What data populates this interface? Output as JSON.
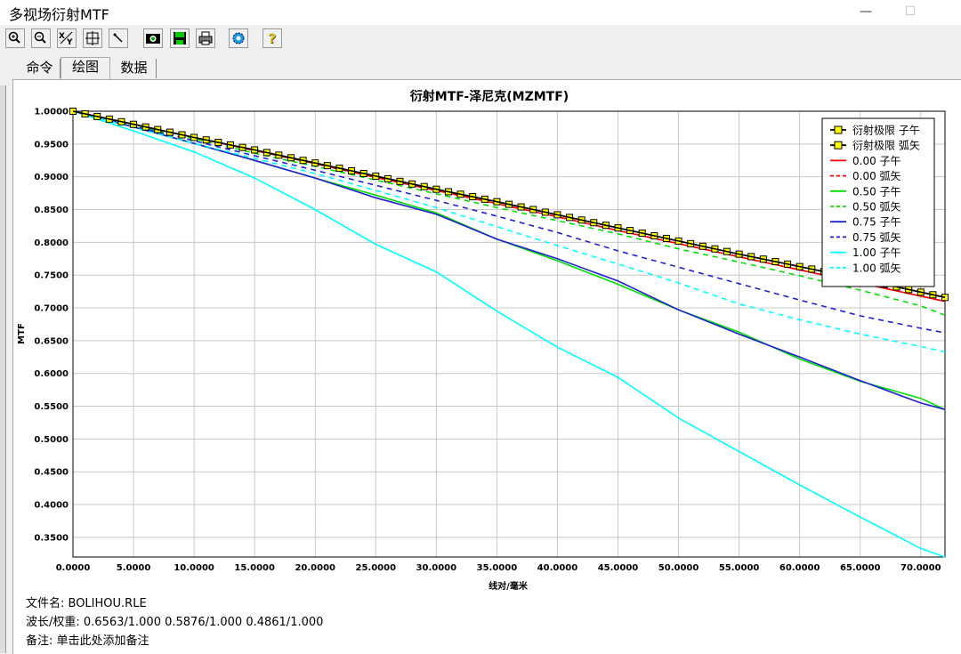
{
  "window": {
    "title": "多视场衍射MTF",
    "minimize": "—",
    "maximize": "☐"
  },
  "toolbar": {
    "icons": [
      "zoom-in-icon",
      "zoom-out-icon",
      "xy-icon",
      "fit-icon",
      "pen-icon",
      "camera-icon",
      "save-icon",
      "print-icon",
      "settings-icon",
      "help-icon"
    ]
  },
  "tabs": [
    {
      "label": "命令"
    },
    {
      "label": "绘图"
    },
    {
      "label": "数据"
    }
  ],
  "info": {
    "filename": "文件名:  BOLIHOU.RLE",
    "wavelengths": "波长/权重:  0.6563/1.000  0.5876/1.000  0.4861/1.000",
    "note": "备注:  单击此处添加备注"
  },
  "chart_data": {
    "type": "line",
    "title": "衍射MTF-泽尼克(MZMTF)",
    "xlabel": "线对/毫米",
    "ylabel": "MTF",
    "xlim": [
      0,
      72
    ],
    "ylim": [
      0.32,
      1.0
    ],
    "xticks": [
      "0.0000",
      "5.0000",
      "10.0000",
      "15.0000",
      "20.0000",
      "25.0000",
      "30.0000",
      "35.0000",
      "40.0000",
      "45.0000",
      "50.0000",
      "55.0000",
      "60.0000",
      "65.0000",
      "70.0000"
    ],
    "yticks": [
      "1.0000",
      "0.9500",
      "0.9000",
      "0.8500",
      "0.8000",
      "0.7500",
      "0.7000",
      "0.6500",
      "0.6000",
      "0.5500",
      "0.5000",
      "0.4500",
      "0.4000",
      "0.3500"
    ],
    "grid": true,
    "legend_position": "top-right",
    "series": [
      {
        "name": "衍射极限 子午",
        "color": "#000000",
        "dash": "",
        "marker": "square",
        "x": [
          0,
          5,
          10,
          15,
          20,
          25,
          30,
          35,
          40,
          45,
          50,
          55,
          60,
          65,
          70,
          72
        ],
        "y": [
          1.0,
          0.98,
          0.96,
          0.941,
          0.921,
          0.901,
          0.881,
          0.862,
          0.842,
          0.822,
          0.802,
          0.782,
          0.763,
          0.744,
          0.724,
          0.716
        ]
      },
      {
        "name": "衍射极限 弧矢",
        "color": "#000000",
        "dash": "",
        "marker": "square",
        "x": [
          0,
          5,
          10,
          15,
          20,
          25,
          30,
          35,
          40,
          45,
          50,
          55,
          60,
          65,
          70,
          72
        ],
        "y": [
          1.0,
          0.98,
          0.96,
          0.941,
          0.921,
          0.901,
          0.881,
          0.862,
          0.842,
          0.822,
          0.802,
          0.782,
          0.763,
          0.744,
          0.724,
          0.716
        ]
      },
      {
        "name": "0.00 子午",
        "color": "#ff0000",
        "dash": "",
        "x": [
          0,
          5,
          10,
          15,
          20,
          25,
          30,
          35,
          40,
          45,
          50,
          55,
          60,
          65,
          70,
          72
        ],
        "y": [
          1.0,
          0.98,
          0.96,
          0.94,
          0.92,
          0.899,
          0.879,
          0.859,
          0.839,
          0.818,
          0.798,
          0.778,
          0.758,
          0.738,
          0.718,
          0.71
        ]
      },
      {
        "name": "0.00 弧矢",
        "color": "#ff0000",
        "dash": "6,5",
        "x": [
          0,
          5,
          10,
          15,
          20,
          25,
          30,
          35,
          40,
          45,
          50,
          55,
          60,
          65,
          70,
          72
        ],
        "y": [
          1.0,
          0.98,
          0.96,
          0.94,
          0.92,
          0.899,
          0.879,
          0.859,
          0.839,
          0.818,
          0.798,
          0.778,
          0.758,
          0.738,
          0.718,
          0.71
        ]
      },
      {
        "name": "0.50 子午",
        "color": "#00e000",
        "dash": "",
        "x": [
          0,
          5,
          10,
          15,
          20,
          25,
          30,
          35,
          40,
          45,
          50,
          55,
          60,
          65,
          70,
          72
        ],
        "y": [
          1.0,
          0.976,
          0.951,
          0.925,
          0.898,
          0.872,
          0.845,
          0.805,
          0.772,
          0.736,
          0.697,
          0.663,
          0.622,
          0.588,
          0.562,
          0.545
        ]
      },
      {
        "name": "0.50 弧矢",
        "color": "#00e000",
        "dash": "6,5",
        "x": [
          0,
          5,
          10,
          15,
          20,
          25,
          30,
          35,
          40,
          45,
          50,
          55,
          60,
          65,
          70,
          72
        ],
        "y": [
          1.0,
          0.978,
          0.958,
          0.936,
          0.916,
          0.895,
          0.874,
          0.853,
          0.833,
          0.813,
          0.79,
          0.77,
          0.749,
          0.727,
          0.703,
          0.689
        ]
      },
      {
        "name": "0.75 子午",
        "color": "#2020d0",
        "dash": "",
        "x": [
          0,
          5,
          10,
          15,
          20,
          25,
          30,
          35,
          40,
          45,
          50,
          55,
          60,
          65,
          70,
          72
        ],
        "y": [
          1.0,
          0.976,
          0.951,
          0.925,
          0.898,
          0.868,
          0.843,
          0.805,
          0.775,
          0.741,
          0.697,
          0.66,
          0.625,
          0.589,
          0.555,
          0.545
        ]
      },
      {
        "name": "0.75 弧矢",
        "color": "#2020d0",
        "dash": "6,5",
        "x": [
          0,
          5,
          10,
          15,
          20,
          25,
          30,
          35,
          40,
          45,
          50,
          55,
          60,
          65,
          70,
          72
        ],
        "y": [
          1.0,
          0.977,
          0.955,
          0.932,
          0.91,
          0.887,
          0.864,
          0.84,
          0.815,
          0.787,
          0.762,
          0.737,
          0.712,
          0.688,
          0.669,
          0.662
        ]
      },
      {
        "name": "1.00 子午",
        "color": "#00ffff",
        "dash": "",
        "x": [
          0,
          5,
          10,
          15,
          20,
          25,
          30,
          35,
          40,
          45,
          50,
          55,
          60,
          65,
          70,
          72
        ],
        "y": [
          1.0,
          0.97,
          0.938,
          0.898,
          0.85,
          0.797,
          0.755,
          0.695,
          0.64,
          0.594,
          0.532,
          0.481,
          0.43,
          0.381,
          0.333,
          0.32
        ]
      },
      {
        "name": "1.00 弧矢",
        "color": "#00ffff",
        "dash": "6,5",
        "x": [
          0,
          5,
          10,
          15,
          20,
          25,
          30,
          35,
          40,
          45,
          50,
          55,
          60,
          65,
          70,
          72
        ],
        "y": [
          1.0,
          0.975,
          0.951,
          0.928,
          0.905,
          0.879,
          0.853,
          0.824,
          0.795,
          0.767,
          0.738,
          0.706,
          0.682,
          0.66,
          0.641,
          0.633
        ]
      }
    ]
  }
}
